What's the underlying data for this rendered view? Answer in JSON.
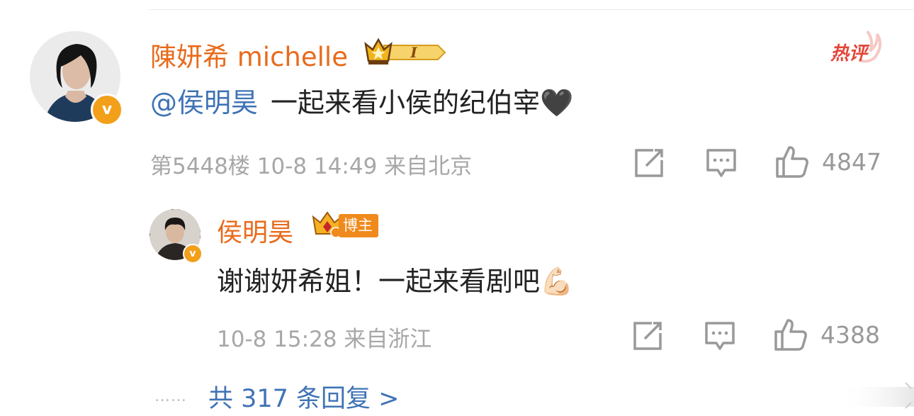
{
  "comment": {
    "username": "陳妍希 michelle",
    "mention": "@侯明昊",
    "text": "一起来看小侯的纪伯宰🖤",
    "hot_badge": "热评",
    "level_badge": "I",
    "floor": "第5448楼",
    "time": "10-8 14:49",
    "location": "来自北京",
    "likes": "4847"
  },
  "reply": {
    "username": "侯明昊",
    "role_badge": "博主",
    "text": "谢谢妍希姐！一起来看剧吧💪🏻",
    "time": "10-8 15:28",
    "location": "来自浙江",
    "likes": "4388"
  },
  "footer": {
    "ellipsis": "……",
    "more_replies": "共 317 条回复 >"
  },
  "icons": {
    "verified": "verified-v-badge",
    "share": "share-icon",
    "reply": "comment-bubble-icon",
    "like": "thumbs-up-icon",
    "crown": "crown-icon"
  },
  "colors": {
    "username": "#e86b1c",
    "mention": "#3f73b5",
    "verified": "#f29f19",
    "hot": "#e2473a",
    "meta": "#a7a7a7"
  }
}
